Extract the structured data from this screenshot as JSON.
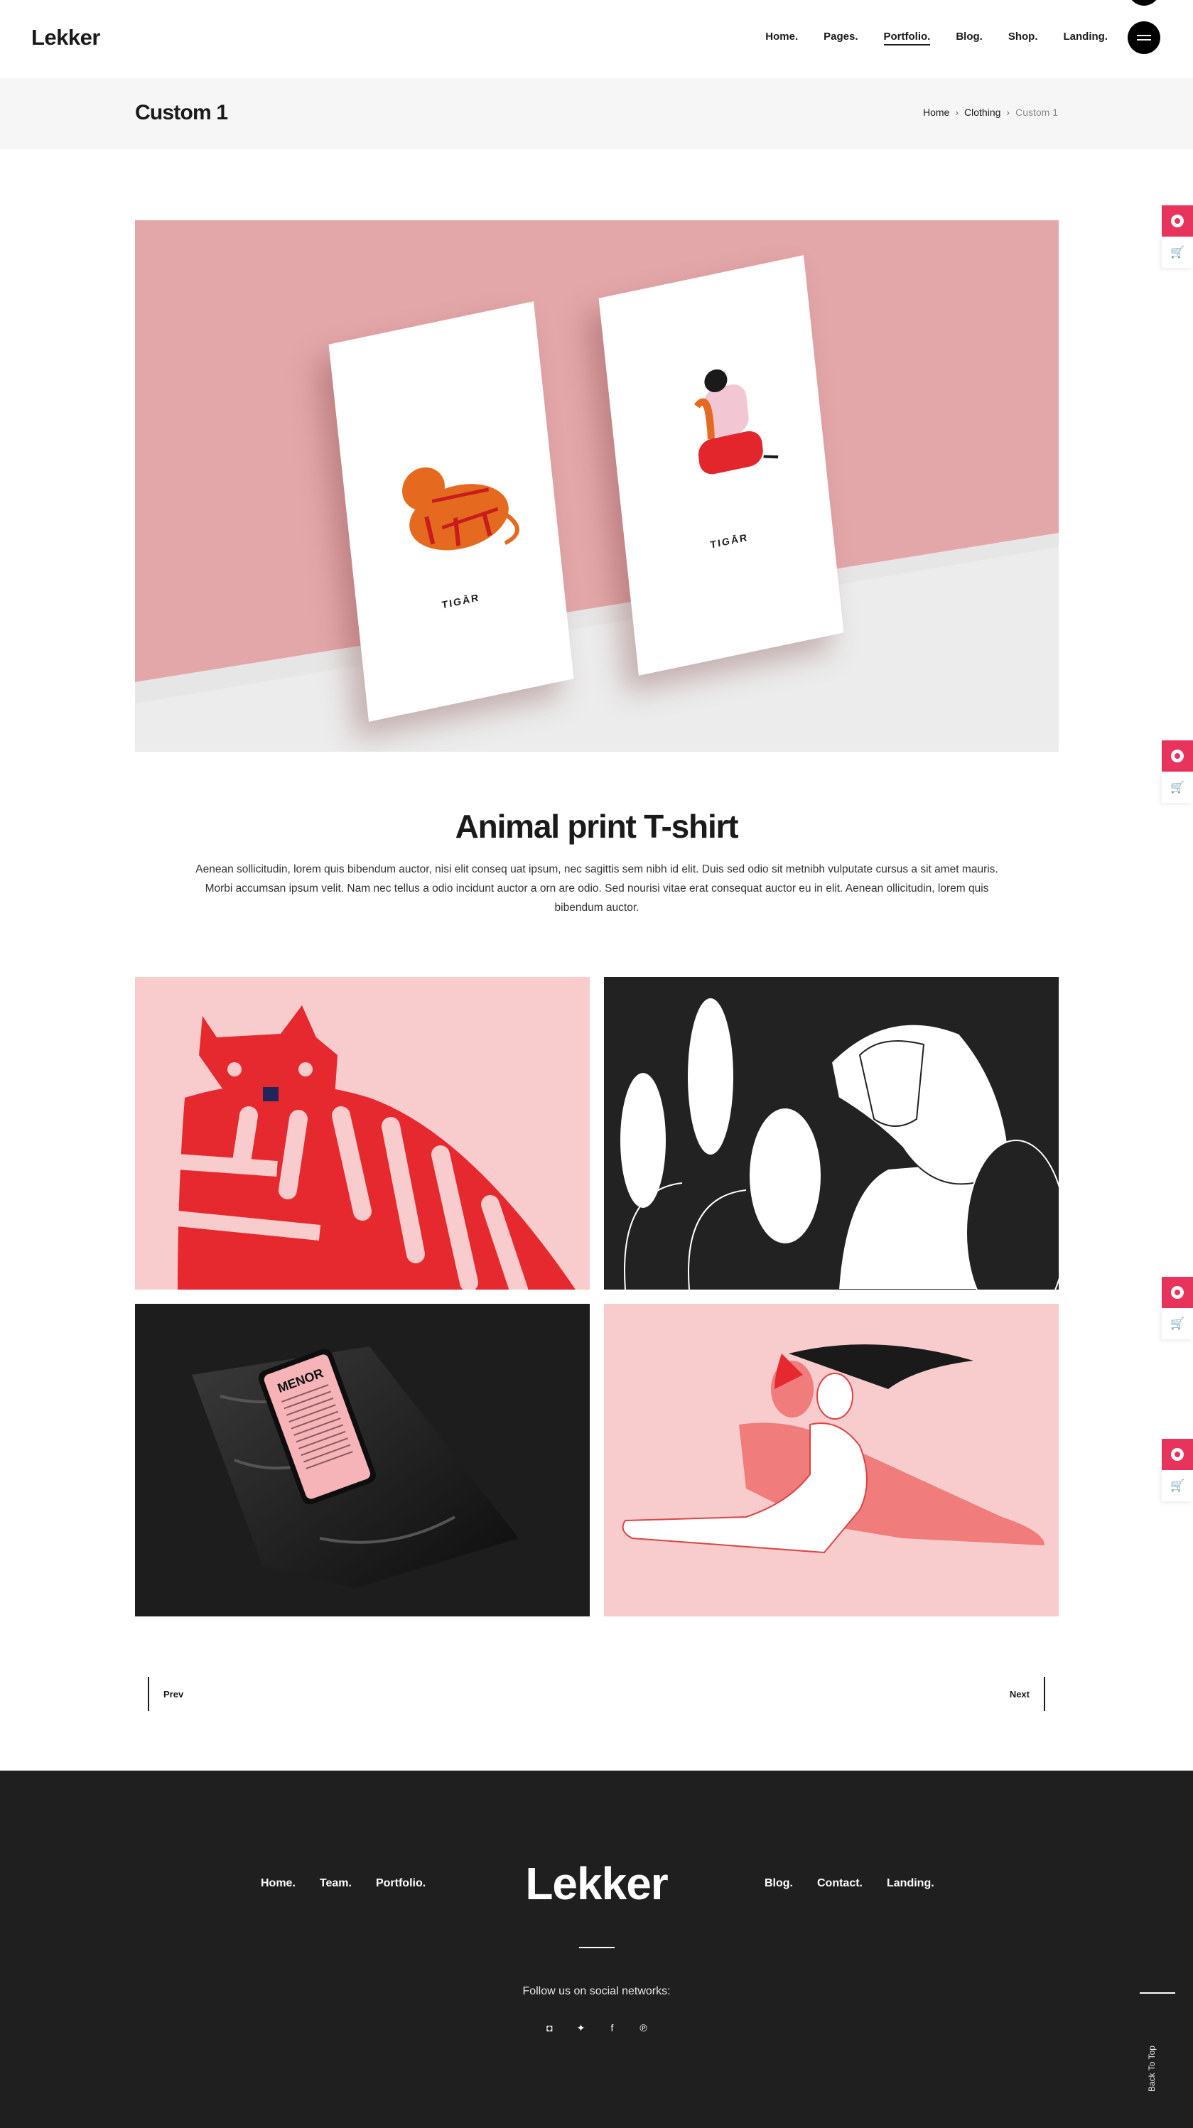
{
  "header": {
    "logo": "Lekker",
    "nav": [
      "Home.",
      "Pages.",
      "Portfolio.",
      "Blog.",
      "Shop.",
      "Landing."
    ],
    "active_nav": "Portfolio."
  },
  "titlebar": {
    "title": "Custom 1",
    "breadcrumb": [
      "Home",
      "Clothing",
      "Custom 1"
    ]
  },
  "hero": {
    "card_label_left": "TIGĀR",
    "card_label_right": "TIGĀR"
  },
  "product": {
    "title": "Animal print T-shirt",
    "description": "Aenean sollicitudin, lorem quis bibendum auctor, nisi elit conseq uat ipsum, nec sagittis sem nibh id elit. Duis sed odio sit metnibh vulputate cursus a sit amet mauris. Morbi accumsan ipsum velit. Nam nec tellus a odio incidunt auctor a orn are odio. Sed nourisi vitae erat consequat auctor eu in elit. Aenean ollicitudin, lorem quis bibendum auctor."
  },
  "gallery": {
    "phone_text": "MENOR"
  },
  "pager": {
    "prev": "Prev",
    "next": "Next"
  },
  "footer": {
    "logo": "Lekker",
    "nav_left": [
      "Home.",
      "Team.",
      "Portfolio."
    ],
    "nav_right": [
      "Blog.",
      "Contact.",
      "Landing."
    ],
    "follow": "Follow us on social networks:",
    "socials": [
      "instagram-icon",
      "twitter-icon",
      "facebook-icon",
      "pinterest-icon"
    ],
    "back_to_top": "Back To Top"
  },
  "colors": {
    "accent": "#e8335d",
    "dark": "#1f1f1f",
    "hero_pink": "#e3a7a9",
    "tile_pink": "#f8cccc",
    "tiger_red": "#e5292f"
  },
  "side_widgets": [
    "target-icon",
    "cart-icon"
  ]
}
